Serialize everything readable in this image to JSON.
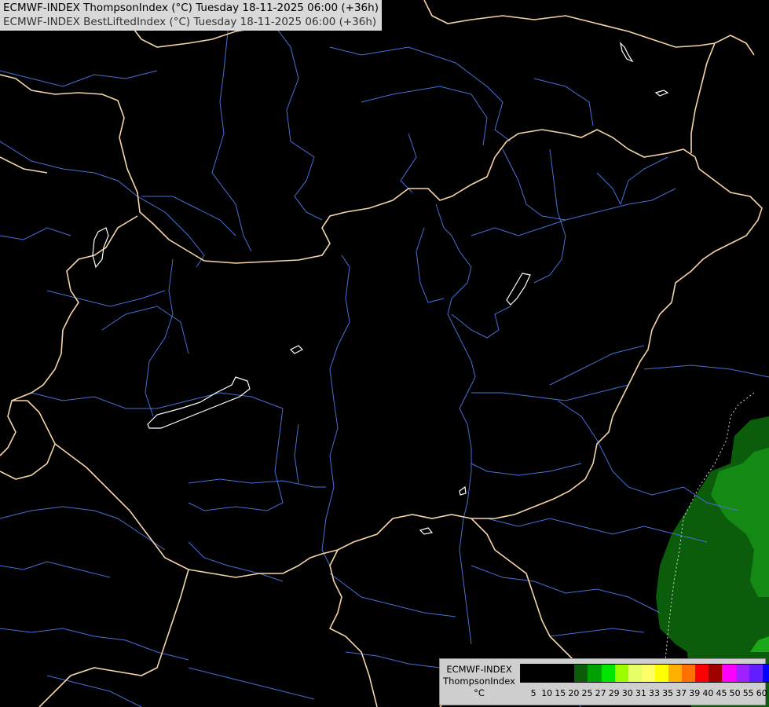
{
  "title": {
    "line1": "ECMWF-INDEX ThompsonIndex (°C) Tuesday 18-11-2025 06:00 (+36h)",
    "line2": "ECMWF-INDEX BestLiftedIndex (°C) Tuesday 18-11-2025 06:00 (+36h)"
  },
  "colors": {
    "background": "#000000",
    "border": "#f5d5a8",
    "river": "#4a6fd8",
    "lake": "#ffffff",
    "field_dark": "#0b5d0b",
    "field_mid": "#148a14"
  },
  "legend": {
    "line1": "ECMWF-INDEX",
    "line2": "ThompsonIndex",
    "line3": "°C",
    "ticks": [
      "5",
      "10",
      "15",
      "20",
      "25",
      "27",
      "29",
      "30",
      "31",
      "33",
      "35",
      "37",
      "39",
      "40",
      "45",
      "50",
      "55",
      "60"
    ],
    "colors": [
      "#000000",
      "#000000",
      "#000000",
      "#000000",
      "#0a5c0a",
      "#00a000",
      "#00e600",
      "#9cff00",
      "#e6ff66",
      "#ffff66",
      "#ffff00",
      "#ffb000",
      "#ff7000",
      "#ff0000",
      "#a00000",
      "#ff00ff",
      "#a020ff",
      "#6020ff",
      "#0000ff"
    ]
  }
}
